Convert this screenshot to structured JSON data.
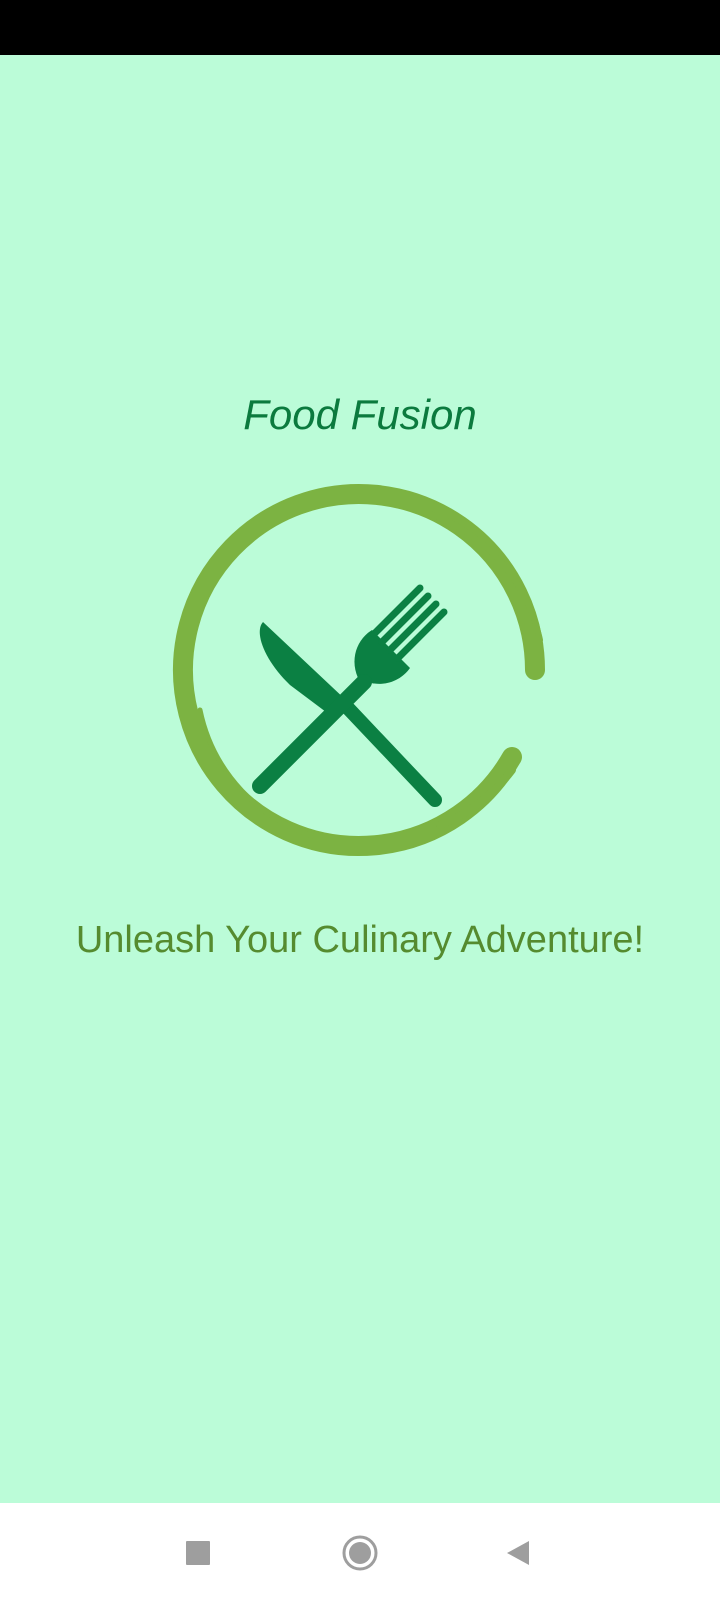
{
  "app": {
    "title": "Food Fusion",
    "tagline": "Unleash Your Culinary Adventure!"
  },
  "logo": {
    "icon": "knife-fork-plate-icon",
    "ring_color": "#7cb342",
    "utensil_color": "#0b8043"
  },
  "colors": {
    "background": "#bbfcd8",
    "title": "#0b7a3e",
    "tagline": "#558b2f",
    "status_bar": "#000000",
    "nav_bar": "#ffffff",
    "nav_icons": "#9e9e9e"
  },
  "navigation": {
    "recents_icon": "square-recents-icon",
    "home_icon": "circle-home-icon",
    "back_icon": "triangle-back-icon"
  }
}
